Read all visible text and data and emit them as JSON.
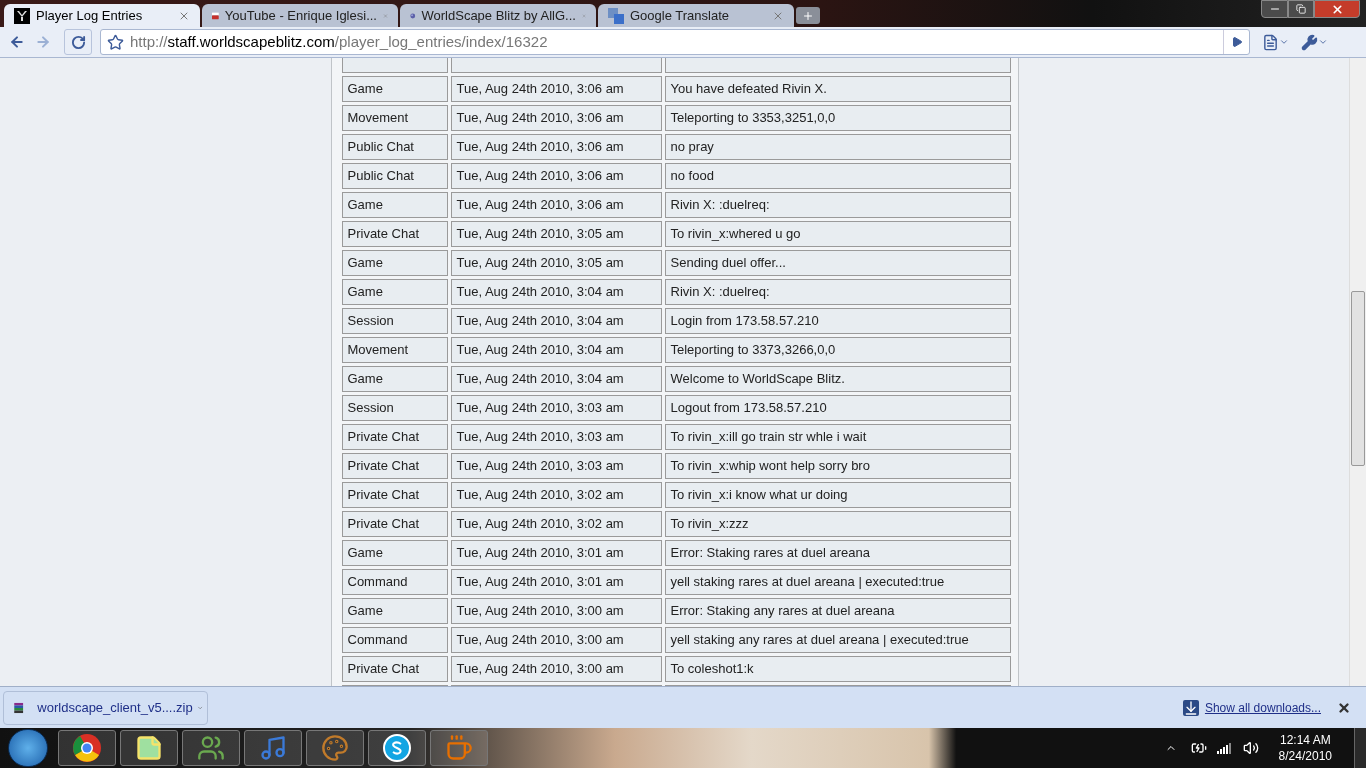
{
  "tabs": [
    {
      "label": "Player Log Entries",
      "selected": true
    },
    {
      "label": "YouTube - Enrique Iglesi...",
      "selected": false
    },
    {
      "label": "WorldScape Blitz by AllG...",
      "selected": false
    },
    {
      "label": "Google Translate",
      "selected": false
    }
  ],
  "address": {
    "scheme": "http://",
    "host": "staff.worldscapeblitz.com",
    "path": "/player_log_entries/index/16322"
  },
  "rows": [
    {
      "type": "Game",
      "time": "Tue, Aug 24th 2010, 3:06 am",
      "message": "You have defeated Rivin X."
    },
    {
      "type": "Movement",
      "time": "Tue, Aug 24th 2010, 3:06 am",
      "message": "Teleporting to 3353,3251,0,0"
    },
    {
      "type": "Public Chat",
      "time": "Tue, Aug 24th 2010, 3:06 am",
      "message": "no pray"
    },
    {
      "type": "Public Chat",
      "time": "Tue, Aug 24th 2010, 3:06 am",
      "message": "no food"
    },
    {
      "type": "Game",
      "time": "Tue, Aug 24th 2010, 3:06 am",
      "message": "Rivin X: :duelreq:"
    },
    {
      "type": "Private Chat",
      "time": "Tue, Aug 24th 2010, 3:05 am",
      "message": "To rivin_x:whered u go"
    },
    {
      "type": "Game",
      "time": "Tue, Aug 24th 2010, 3:05 am",
      "message": "Sending duel offer..."
    },
    {
      "type": "Game",
      "time": "Tue, Aug 24th 2010, 3:04 am",
      "message": "Rivin X: :duelreq:"
    },
    {
      "type": "Session",
      "time": "Tue, Aug 24th 2010, 3:04 am",
      "message": "Login from 173.58.57.210"
    },
    {
      "type": "Movement",
      "time": "Tue, Aug 24th 2010, 3:04 am",
      "message": "Teleporting to 3373,3266,0,0"
    },
    {
      "type": "Game",
      "time": "Tue, Aug 24th 2010, 3:04 am",
      "message": "Welcome to WorldScape Blitz."
    },
    {
      "type": "Session",
      "time": "Tue, Aug 24th 2010, 3:03 am",
      "message": "Logout from 173.58.57.210"
    },
    {
      "type": "Private Chat",
      "time": "Tue, Aug 24th 2010, 3:03 am",
      "message": "To rivin_x:ill go train str whle i wait"
    },
    {
      "type": "Private Chat",
      "time": "Tue, Aug 24th 2010, 3:03 am",
      "message": "To rivin_x:whip wont help sorry bro"
    },
    {
      "type": "Private Chat",
      "time": "Tue, Aug 24th 2010, 3:02 am",
      "message": "To rivin_x:i know what ur doing"
    },
    {
      "type": "Private Chat",
      "time": "Tue, Aug 24th 2010, 3:02 am",
      "message": "To rivin_x:zzz"
    },
    {
      "type": "Game",
      "time": "Tue, Aug 24th 2010, 3:01 am",
      "message": "Error: Staking rares at duel areana"
    },
    {
      "type": "Command",
      "time": "Tue, Aug 24th 2010, 3:01 am",
      "message": "yell staking rares at duel areana | executed:true"
    },
    {
      "type": "Game",
      "time": "Tue, Aug 24th 2010, 3:00 am",
      "message": "Error: Staking any rares at duel areana"
    },
    {
      "type": "Command",
      "time": "Tue, Aug 24th 2010, 3:00 am",
      "message": "yell staking any rares at duel areana | executed:true"
    },
    {
      "type": "Private Chat",
      "time": "Tue, Aug 24th 2010, 3:00 am",
      "message": "To coleshot1:k"
    }
  ],
  "download": {
    "file": "worldscape_client_v5....zip",
    "show_all": "Show all downloads..."
  },
  "taskbar": {
    "time": "12:14 AM",
    "date": "8/24/2010"
  }
}
